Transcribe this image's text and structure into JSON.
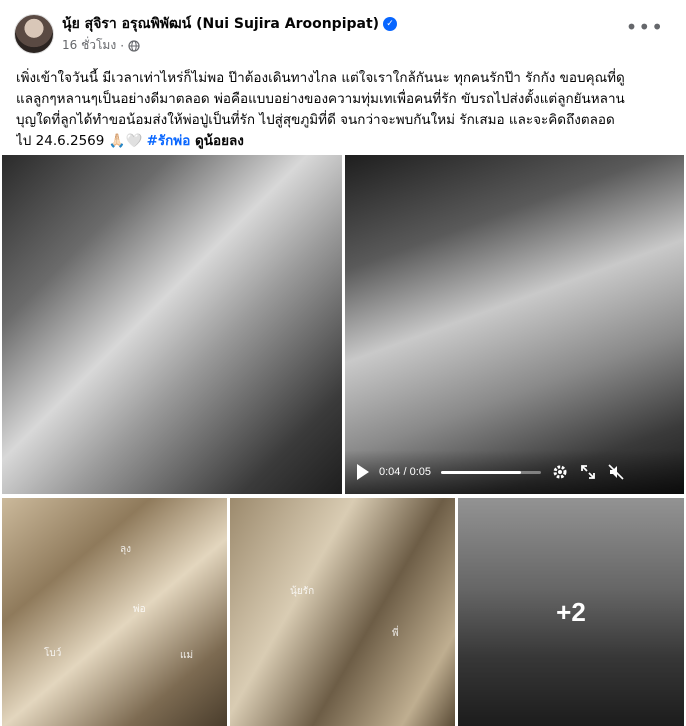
{
  "post": {
    "author": "นุ้ย สุจิรา อรุณพิพัฒน์ (Nui Sujira Aroonpipat)",
    "time": "16 ชั่วโมง",
    "separator": "·",
    "lines": [
      "เพิ่งเข้าใจวันนี้ มีเวลาเท่าไหร่ก็ไม่พอ ป๊าต้องเดินทางไกล แต่ใจเราใกล้กันนะ ทุกคนรักป๊า รักกัง ขอบคุณที่ดู",
      "แลลูกๆหลานๆเป็นอย่างดีมาตลอด พ่อคือแบบอย่างของความทุ่มเทเพื่อคนที่รัก ขับรถไปส่งตั้งแต่ลูกยันหลาน",
      "บุญใดที่ลูกได้ทำขอน้อมส่งให้พ่อปู่เป็นที่รัก ไปสู่สุขภูมิที่ดี จนกว่าจะพบกันใหม่ รักเสมอ และจะคิดถึงตลอด"
    ],
    "last_line_text": "ไป 24.6.2569 🙏🏻🤍 ",
    "hashtag": "#รักพ่อ",
    "see_more": " ดูน้อยลง"
  },
  "media": {
    "photo_labels": {
      "p3_a": "ลุง",
      "p3_b": "พ่อ",
      "p3_c": "โบว์",
      "p3_d": "แม่",
      "p4_a": "นุ้ยรัก",
      "p4_b": "พี่"
    },
    "more_count": "+2",
    "video": {
      "time_display": "0:04 / 0:05",
      "progress": 0.8
    }
  },
  "icons": {
    "verified": "verified-badge-icon",
    "globe": "globe-icon",
    "more": "more-options-icon",
    "play": "play-icon",
    "settings": "gear-icon",
    "fullscreen": "fullscreen-icon",
    "mute": "mute-icon"
  },
  "colors": {
    "accent": "#0866ff",
    "secondary_text": "#65676b"
  }
}
